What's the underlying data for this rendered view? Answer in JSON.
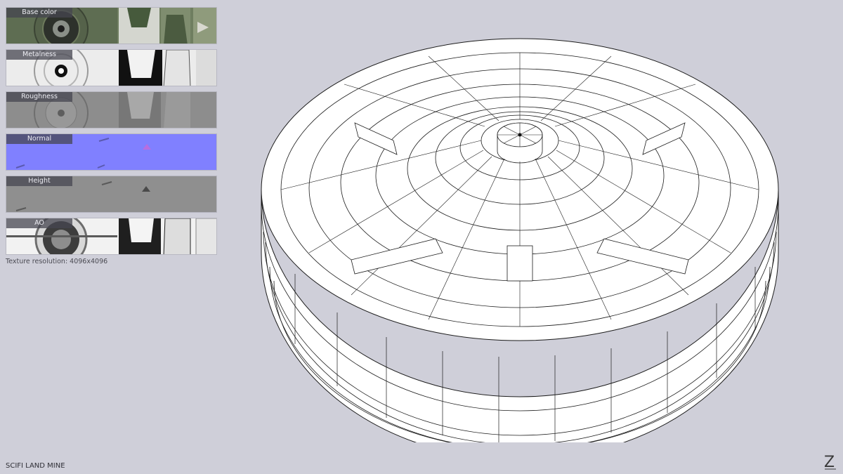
{
  "textures": [
    {
      "id": "base",
      "label": "Base color",
      "bg": "#6f7e60"
    },
    {
      "id": "metal",
      "label": "Metalness",
      "bg": "#e7e7e7"
    },
    {
      "id": "rough",
      "label": "Roughness",
      "bg": "#8a8a8a"
    },
    {
      "id": "normal",
      "label": "Normal",
      "bg": "#8080ff"
    },
    {
      "id": "height",
      "label": "Height",
      "bg": "#8e8e8e"
    },
    {
      "id": "ao",
      "label": "AO",
      "bg": "#f2f2f2"
    }
  ],
  "resolution_text": "Texture resolution: 4096x4096",
  "model_title": "SCIFI LAND MINE",
  "logo_text": "Z",
  "colors": {
    "background": "#cfcfd9",
    "wire": "#1c1c1c",
    "mesh": "#ffffff"
  }
}
